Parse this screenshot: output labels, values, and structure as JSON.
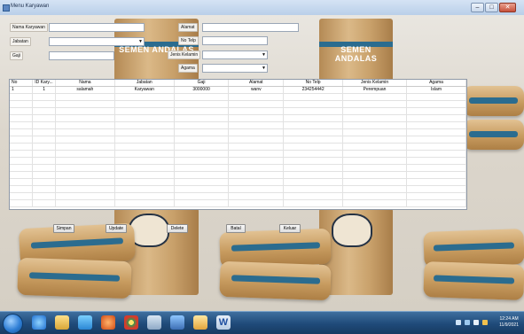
{
  "window": {
    "title": "Menu Karyawan",
    "controls": {
      "minimize": "–",
      "maximize": "□",
      "close": "✕"
    }
  },
  "background": {
    "brand_top_left": "SEMEN ANDALAS",
    "brand_top_right": "SEMEN ANDALAS"
  },
  "form": {
    "nama_label": "Nama Karyawan",
    "nama_value": "",
    "jabatan_label": "Jabatan",
    "jabatan_value": "",
    "gaji_label": "Gaji",
    "gaji_value": "",
    "alamat_label": "Alamat",
    "alamat_value": "",
    "notelp_label": "No Telp",
    "notelp_value": "",
    "jenis_kelamin_label": "Jenis Kelamin",
    "jenis_kelamin_value": "",
    "agama_label": "Agama",
    "agama_value": ""
  },
  "grid": {
    "columns": [
      "No",
      "ID Kary...",
      "Nama",
      "Jabatan",
      "Gaji",
      "Alamat",
      "No Telp",
      "Jenis Kelamin",
      "Agama"
    ],
    "rows": [
      [
        "1",
        "1",
        "salamah",
        "Karyawan",
        "3000000",
        "wanv",
        "234254442",
        "Perempuan",
        "Islam"
      ]
    ]
  },
  "buttons": {
    "simpan": "Simpan",
    "update": "Update",
    "delete": "Delete",
    "batal": "Batal",
    "keluar": "Keluar"
  },
  "taskbar": {
    "time": "12:24 AM",
    "date": "11/9/2021",
    "word_icon_label": "W"
  },
  "colors": {
    "taskbar": "#1f4a79",
    "brand_blue": "#2b6c8f",
    "bag": "#c8a06a"
  }
}
